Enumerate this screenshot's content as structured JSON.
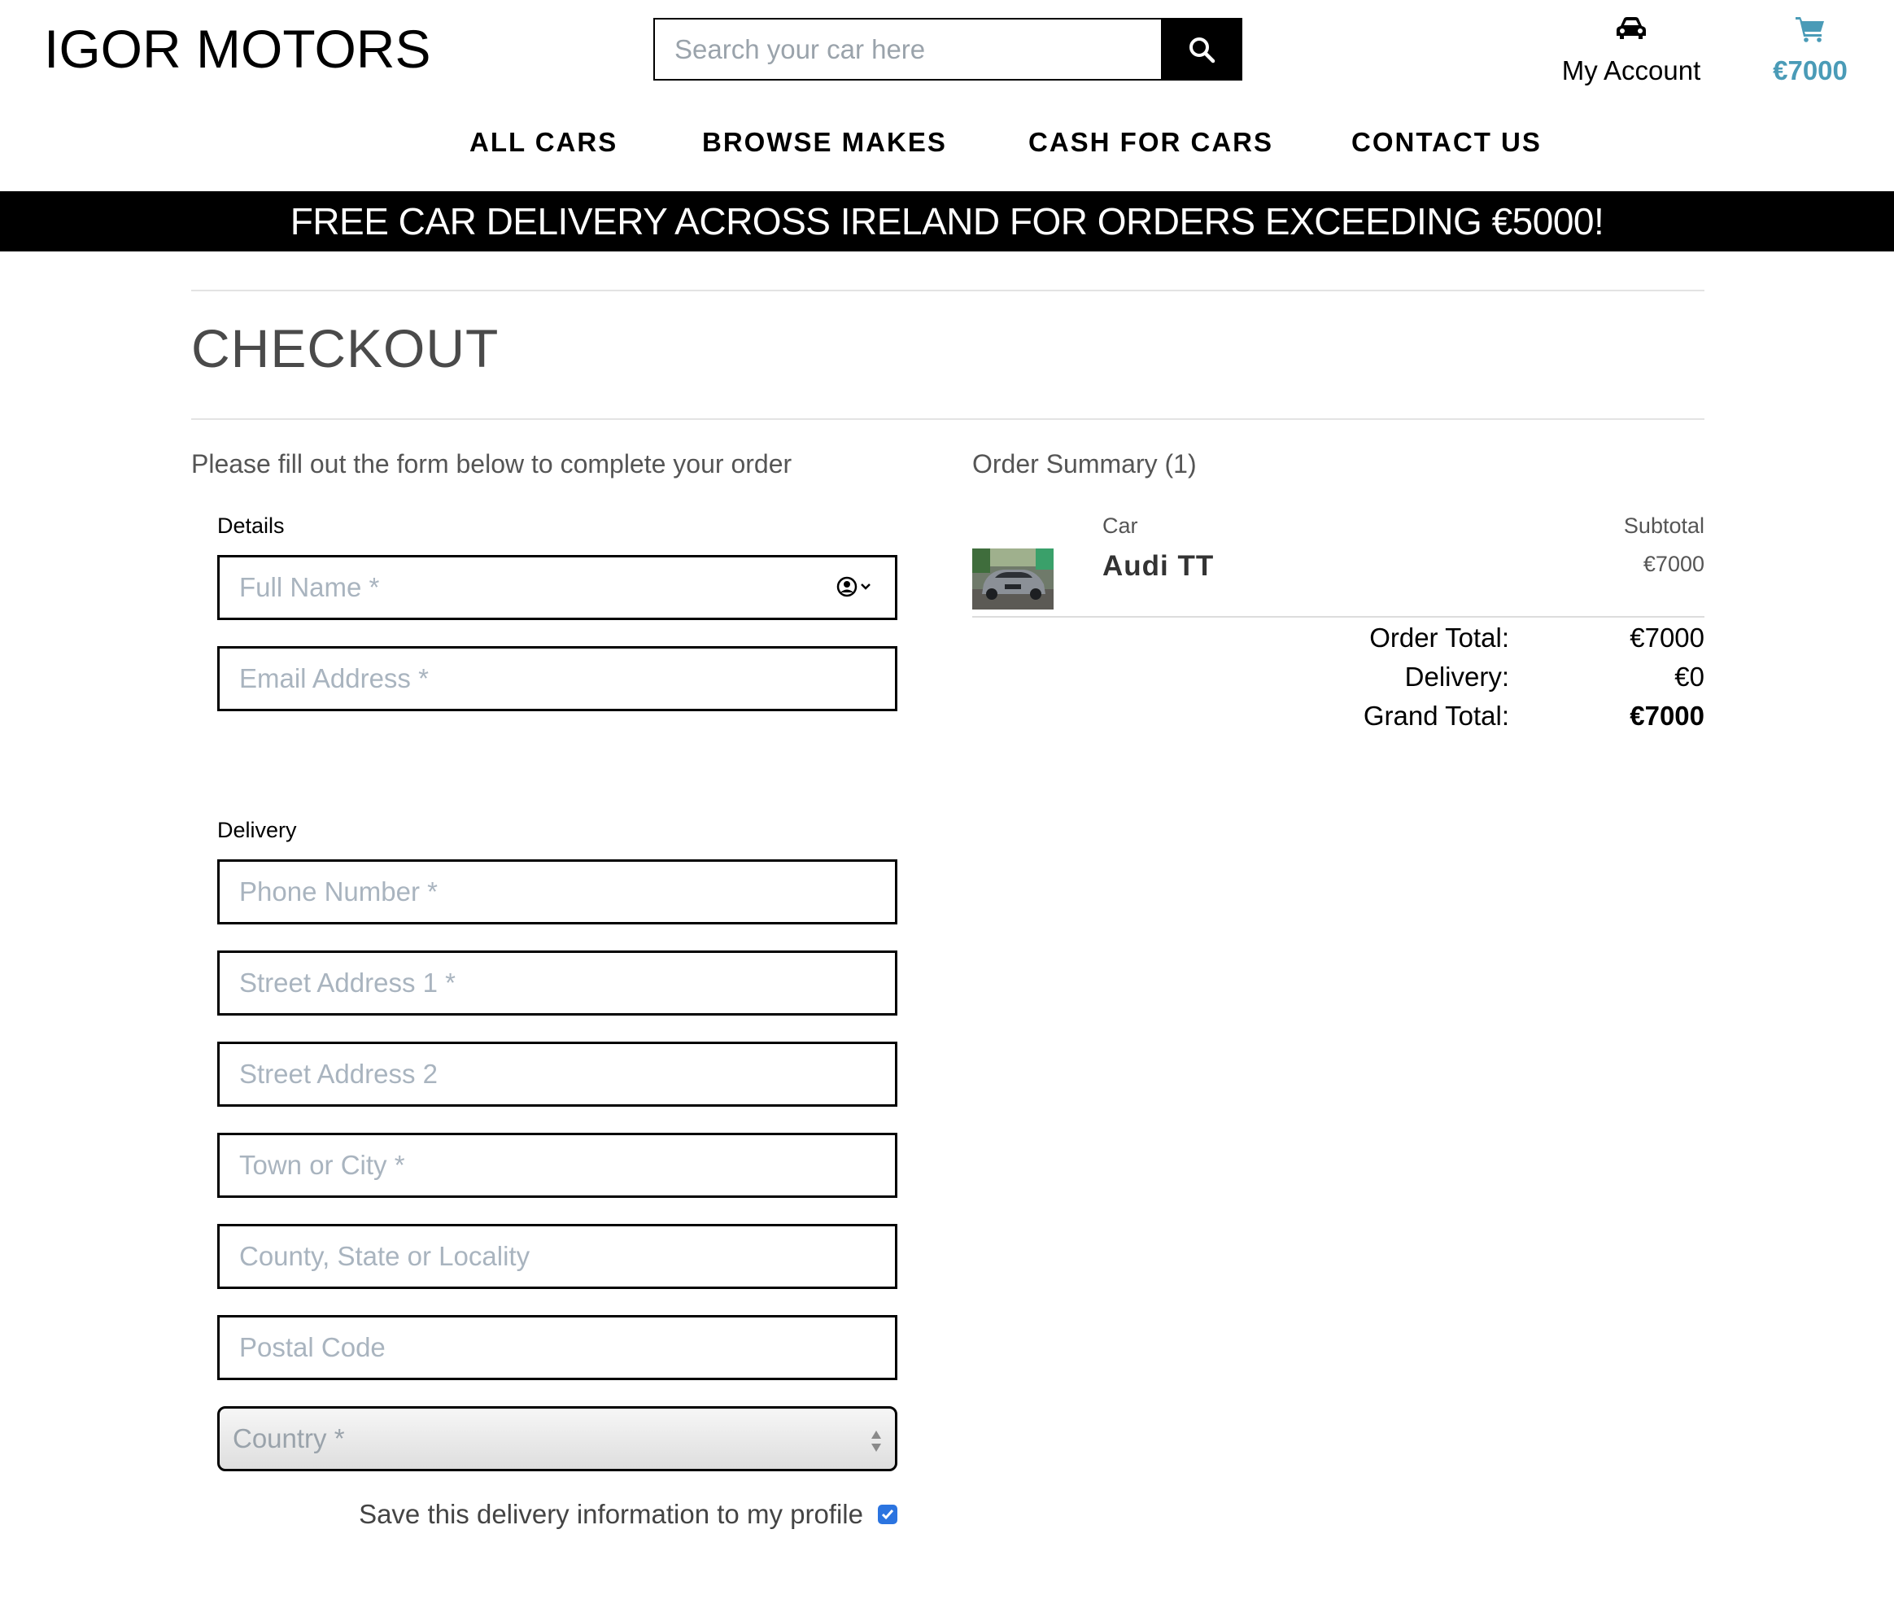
{
  "header": {
    "logo": "IGOR MOTORS",
    "search_placeholder": "Search your car here",
    "account_label": "My Account",
    "cart_total": "€7000",
    "cart_color": "#4a9bb7"
  },
  "nav": {
    "items": [
      "ALL CARS",
      "BROWSE MAKES",
      "CASH FOR CARS",
      "CONTACT US"
    ]
  },
  "banner": {
    "text": "FREE CAR DELIVERY ACROSS IRELAND FOR ORDERS EXCEEDING €5000!"
  },
  "checkout": {
    "title": "CHECKOUT",
    "intro": "Please fill out the form below to complete your order",
    "details_label": "Details",
    "details_fields": {
      "full_name": "Full Name *",
      "email": "Email Address *"
    },
    "delivery_label": "Delivery",
    "delivery_fields": {
      "phone": "Phone Number *",
      "street1": "Street Address 1 *",
      "street2": "Street Address 2",
      "town": "Town or City *",
      "county": "County, State or Locality",
      "postcode": "Postal Code",
      "country": "Country *"
    },
    "save_info_label": "Save this delivery information to my profile",
    "save_info_checked": true,
    "checkbox_color": "#2b74e0"
  },
  "summary": {
    "title": "Order Summary (1)",
    "col_car": "Car",
    "col_subtotal": "Subtotal",
    "item": {
      "name": "Audi TT",
      "price": "€7000"
    },
    "order_total_label": "Order Total:",
    "order_total": "€7000",
    "delivery_label": "Delivery:",
    "delivery": "€0",
    "grand_total_label": "Grand Total:",
    "grand_total": "€7000"
  }
}
